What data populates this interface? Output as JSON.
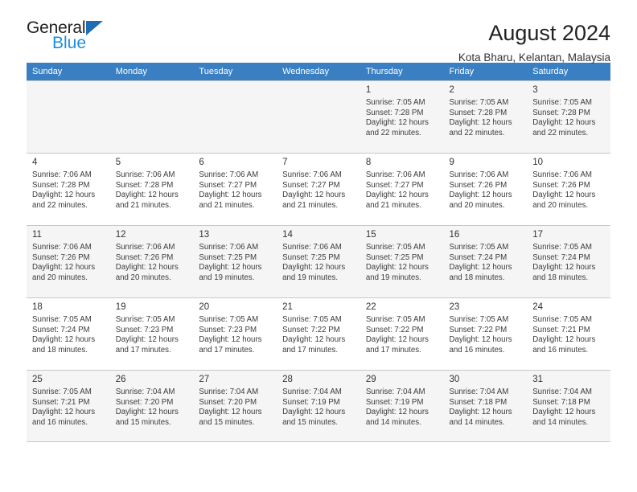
{
  "brand": {
    "name_part1": "General",
    "name_part2": "Blue",
    "triangle_color": "#1f6eb5",
    "blue_color": "#1c8ede"
  },
  "header": {
    "title": "August 2024",
    "location": "Kota Bharu, Kelantan, Malaysia"
  },
  "theme": {
    "header_row_bg": "#3a7fc1",
    "header_row_text": "#ffffff",
    "shaded_row_bg": "#f5f5f5",
    "grid_line": "#c8c8c8"
  },
  "weekdays": [
    "Sunday",
    "Monday",
    "Tuesday",
    "Wednesday",
    "Thursday",
    "Friday",
    "Saturday"
  ],
  "weeks": [
    [
      {
        "day": "",
        "detail": ""
      },
      {
        "day": "",
        "detail": ""
      },
      {
        "day": "",
        "detail": ""
      },
      {
        "day": "",
        "detail": ""
      },
      {
        "day": "1",
        "detail": "Sunrise: 7:05 AM\nSunset: 7:28 PM\nDaylight: 12 hours\nand 22 minutes."
      },
      {
        "day": "2",
        "detail": "Sunrise: 7:05 AM\nSunset: 7:28 PM\nDaylight: 12 hours\nand 22 minutes."
      },
      {
        "day": "3",
        "detail": "Sunrise: 7:05 AM\nSunset: 7:28 PM\nDaylight: 12 hours\nand 22 minutes."
      }
    ],
    [
      {
        "day": "4",
        "detail": "Sunrise: 7:06 AM\nSunset: 7:28 PM\nDaylight: 12 hours\nand 22 minutes."
      },
      {
        "day": "5",
        "detail": "Sunrise: 7:06 AM\nSunset: 7:28 PM\nDaylight: 12 hours\nand 21 minutes."
      },
      {
        "day": "6",
        "detail": "Sunrise: 7:06 AM\nSunset: 7:27 PM\nDaylight: 12 hours\nand 21 minutes."
      },
      {
        "day": "7",
        "detail": "Sunrise: 7:06 AM\nSunset: 7:27 PM\nDaylight: 12 hours\nand 21 minutes."
      },
      {
        "day": "8",
        "detail": "Sunrise: 7:06 AM\nSunset: 7:27 PM\nDaylight: 12 hours\nand 21 minutes."
      },
      {
        "day": "9",
        "detail": "Sunrise: 7:06 AM\nSunset: 7:26 PM\nDaylight: 12 hours\nand 20 minutes."
      },
      {
        "day": "10",
        "detail": "Sunrise: 7:06 AM\nSunset: 7:26 PM\nDaylight: 12 hours\nand 20 minutes."
      }
    ],
    [
      {
        "day": "11",
        "detail": "Sunrise: 7:06 AM\nSunset: 7:26 PM\nDaylight: 12 hours\nand 20 minutes."
      },
      {
        "day": "12",
        "detail": "Sunrise: 7:06 AM\nSunset: 7:26 PM\nDaylight: 12 hours\nand 20 minutes."
      },
      {
        "day": "13",
        "detail": "Sunrise: 7:06 AM\nSunset: 7:25 PM\nDaylight: 12 hours\nand 19 minutes."
      },
      {
        "day": "14",
        "detail": "Sunrise: 7:06 AM\nSunset: 7:25 PM\nDaylight: 12 hours\nand 19 minutes."
      },
      {
        "day": "15",
        "detail": "Sunrise: 7:05 AM\nSunset: 7:25 PM\nDaylight: 12 hours\nand 19 minutes."
      },
      {
        "day": "16",
        "detail": "Sunrise: 7:05 AM\nSunset: 7:24 PM\nDaylight: 12 hours\nand 18 minutes."
      },
      {
        "day": "17",
        "detail": "Sunrise: 7:05 AM\nSunset: 7:24 PM\nDaylight: 12 hours\nand 18 minutes."
      }
    ],
    [
      {
        "day": "18",
        "detail": "Sunrise: 7:05 AM\nSunset: 7:24 PM\nDaylight: 12 hours\nand 18 minutes."
      },
      {
        "day": "19",
        "detail": "Sunrise: 7:05 AM\nSunset: 7:23 PM\nDaylight: 12 hours\nand 17 minutes."
      },
      {
        "day": "20",
        "detail": "Sunrise: 7:05 AM\nSunset: 7:23 PM\nDaylight: 12 hours\nand 17 minutes."
      },
      {
        "day": "21",
        "detail": "Sunrise: 7:05 AM\nSunset: 7:22 PM\nDaylight: 12 hours\nand 17 minutes."
      },
      {
        "day": "22",
        "detail": "Sunrise: 7:05 AM\nSunset: 7:22 PM\nDaylight: 12 hours\nand 17 minutes."
      },
      {
        "day": "23",
        "detail": "Sunrise: 7:05 AM\nSunset: 7:22 PM\nDaylight: 12 hours\nand 16 minutes."
      },
      {
        "day": "24",
        "detail": "Sunrise: 7:05 AM\nSunset: 7:21 PM\nDaylight: 12 hours\nand 16 minutes."
      }
    ],
    [
      {
        "day": "25",
        "detail": "Sunrise: 7:05 AM\nSunset: 7:21 PM\nDaylight: 12 hours\nand 16 minutes."
      },
      {
        "day": "26",
        "detail": "Sunrise: 7:04 AM\nSunset: 7:20 PM\nDaylight: 12 hours\nand 15 minutes."
      },
      {
        "day": "27",
        "detail": "Sunrise: 7:04 AM\nSunset: 7:20 PM\nDaylight: 12 hours\nand 15 minutes."
      },
      {
        "day": "28",
        "detail": "Sunrise: 7:04 AM\nSunset: 7:19 PM\nDaylight: 12 hours\nand 15 minutes."
      },
      {
        "day": "29",
        "detail": "Sunrise: 7:04 AM\nSunset: 7:19 PM\nDaylight: 12 hours\nand 14 minutes."
      },
      {
        "day": "30",
        "detail": "Sunrise: 7:04 AM\nSunset: 7:18 PM\nDaylight: 12 hours\nand 14 minutes."
      },
      {
        "day": "31",
        "detail": "Sunrise: 7:04 AM\nSunset: 7:18 PM\nDaylight: 12 hours\nand 14 minutes."
      }
    ]
  ]
}
